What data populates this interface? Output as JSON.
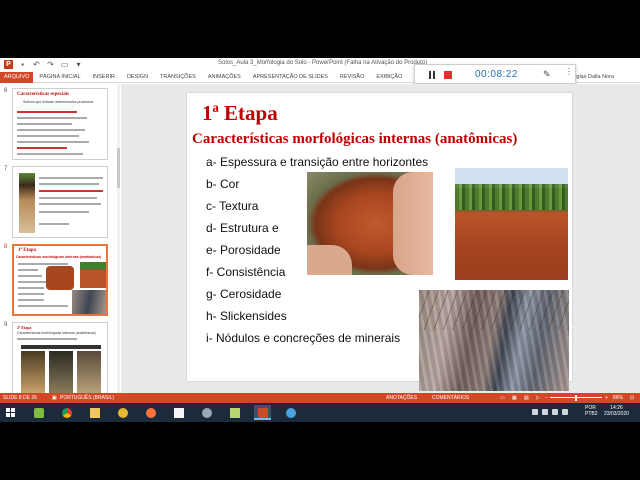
{
  "window": {
    "title": "Solos_Aula 3_Morfologia do Solo - PowerPoint (Falha na Ativação do Produto)",
    "user": "Douglas Dalla Nora"
  },
  "ribbon": {
    "tabs": [
      "ARQUIVO",
      "PÁGINA INICIAL",
      "INSERIR",
      "DESIGN",
      "TRANSIÇÕES",
      "ANIMAÇÕES",
      "APRESENTAÇÃO DE SLIDES",
      "REVISÃO",
      "EXIBIÇÃO"
    ]
  },
  "recorder": {
    "time": "00:08:22",
    "pause_icon": "pause-icon",
    "stop_icon": "stop-icon",
    "pen_icon": "pen-icon"
  },
  "thumbnails": [
    {
      "number": "6",
      "title": "Características especiais",
      "subtitle": "Sufixos que indicam determinados processos"
    },
    {
      "number": "7",
      "title": "",
      "subtitle": ""
    },
    {
      "number": "8",
      "title": "1ª Etapa",
      "subtitle": "Características morfológicas internas (anatômicas)"
    },
    {
      "number": "9",
      "title": "2ª Etapa",
      "subtitle": "Características morfológicas internas (anatômicas)"
    }
  ],
  "slide": {
    "title": "1ª Etapa",
    "subtitle": "Características morfológicas internas (anatômicas)",
    "items": [
      "a- Espessura e transição entre horizontes",
      "b- Cor",
      "c- Textura",
      "d- Estrutura e",
      "e- Porosidade",
      "f- Consistência",
      "g- Cerosidade",
      "h- Slickensides",
      "i- Nódulos e concreções de minerais"
    ]
  },
  "statusbar": {
    "slide_count": "SLIDE 8 DE 26",
    "language": "PORTUGUÊS (BRASIL)",
    "notes": "ANOTAÇÕES",
    "comments": "COMENTÁRIOS",
    "zoom": "86%"
  },
  "taskbar": {
    "apps": [
      "start-icon",
      "bluestacks-icon",
      "chrome-icon",
      "file-explorer-icon",
      "paint-icon",
      "firefox-icon",
      "document-icon",
      "network-icon",
      "image-viewer-icon",
      "powerpoint-icon",
      "screen-recorder-icon"
    ],
    "lang_top": "POR",
    "lang_bottom": "PTB2",
    "time": "14:26",
    "date": "23/03/2020",
    "colors": {
      "accent": "#d24726",
      "taskbar": "#1c2b3c",
      "recorder_time": "#1f6fb2"
    }
  }
}
